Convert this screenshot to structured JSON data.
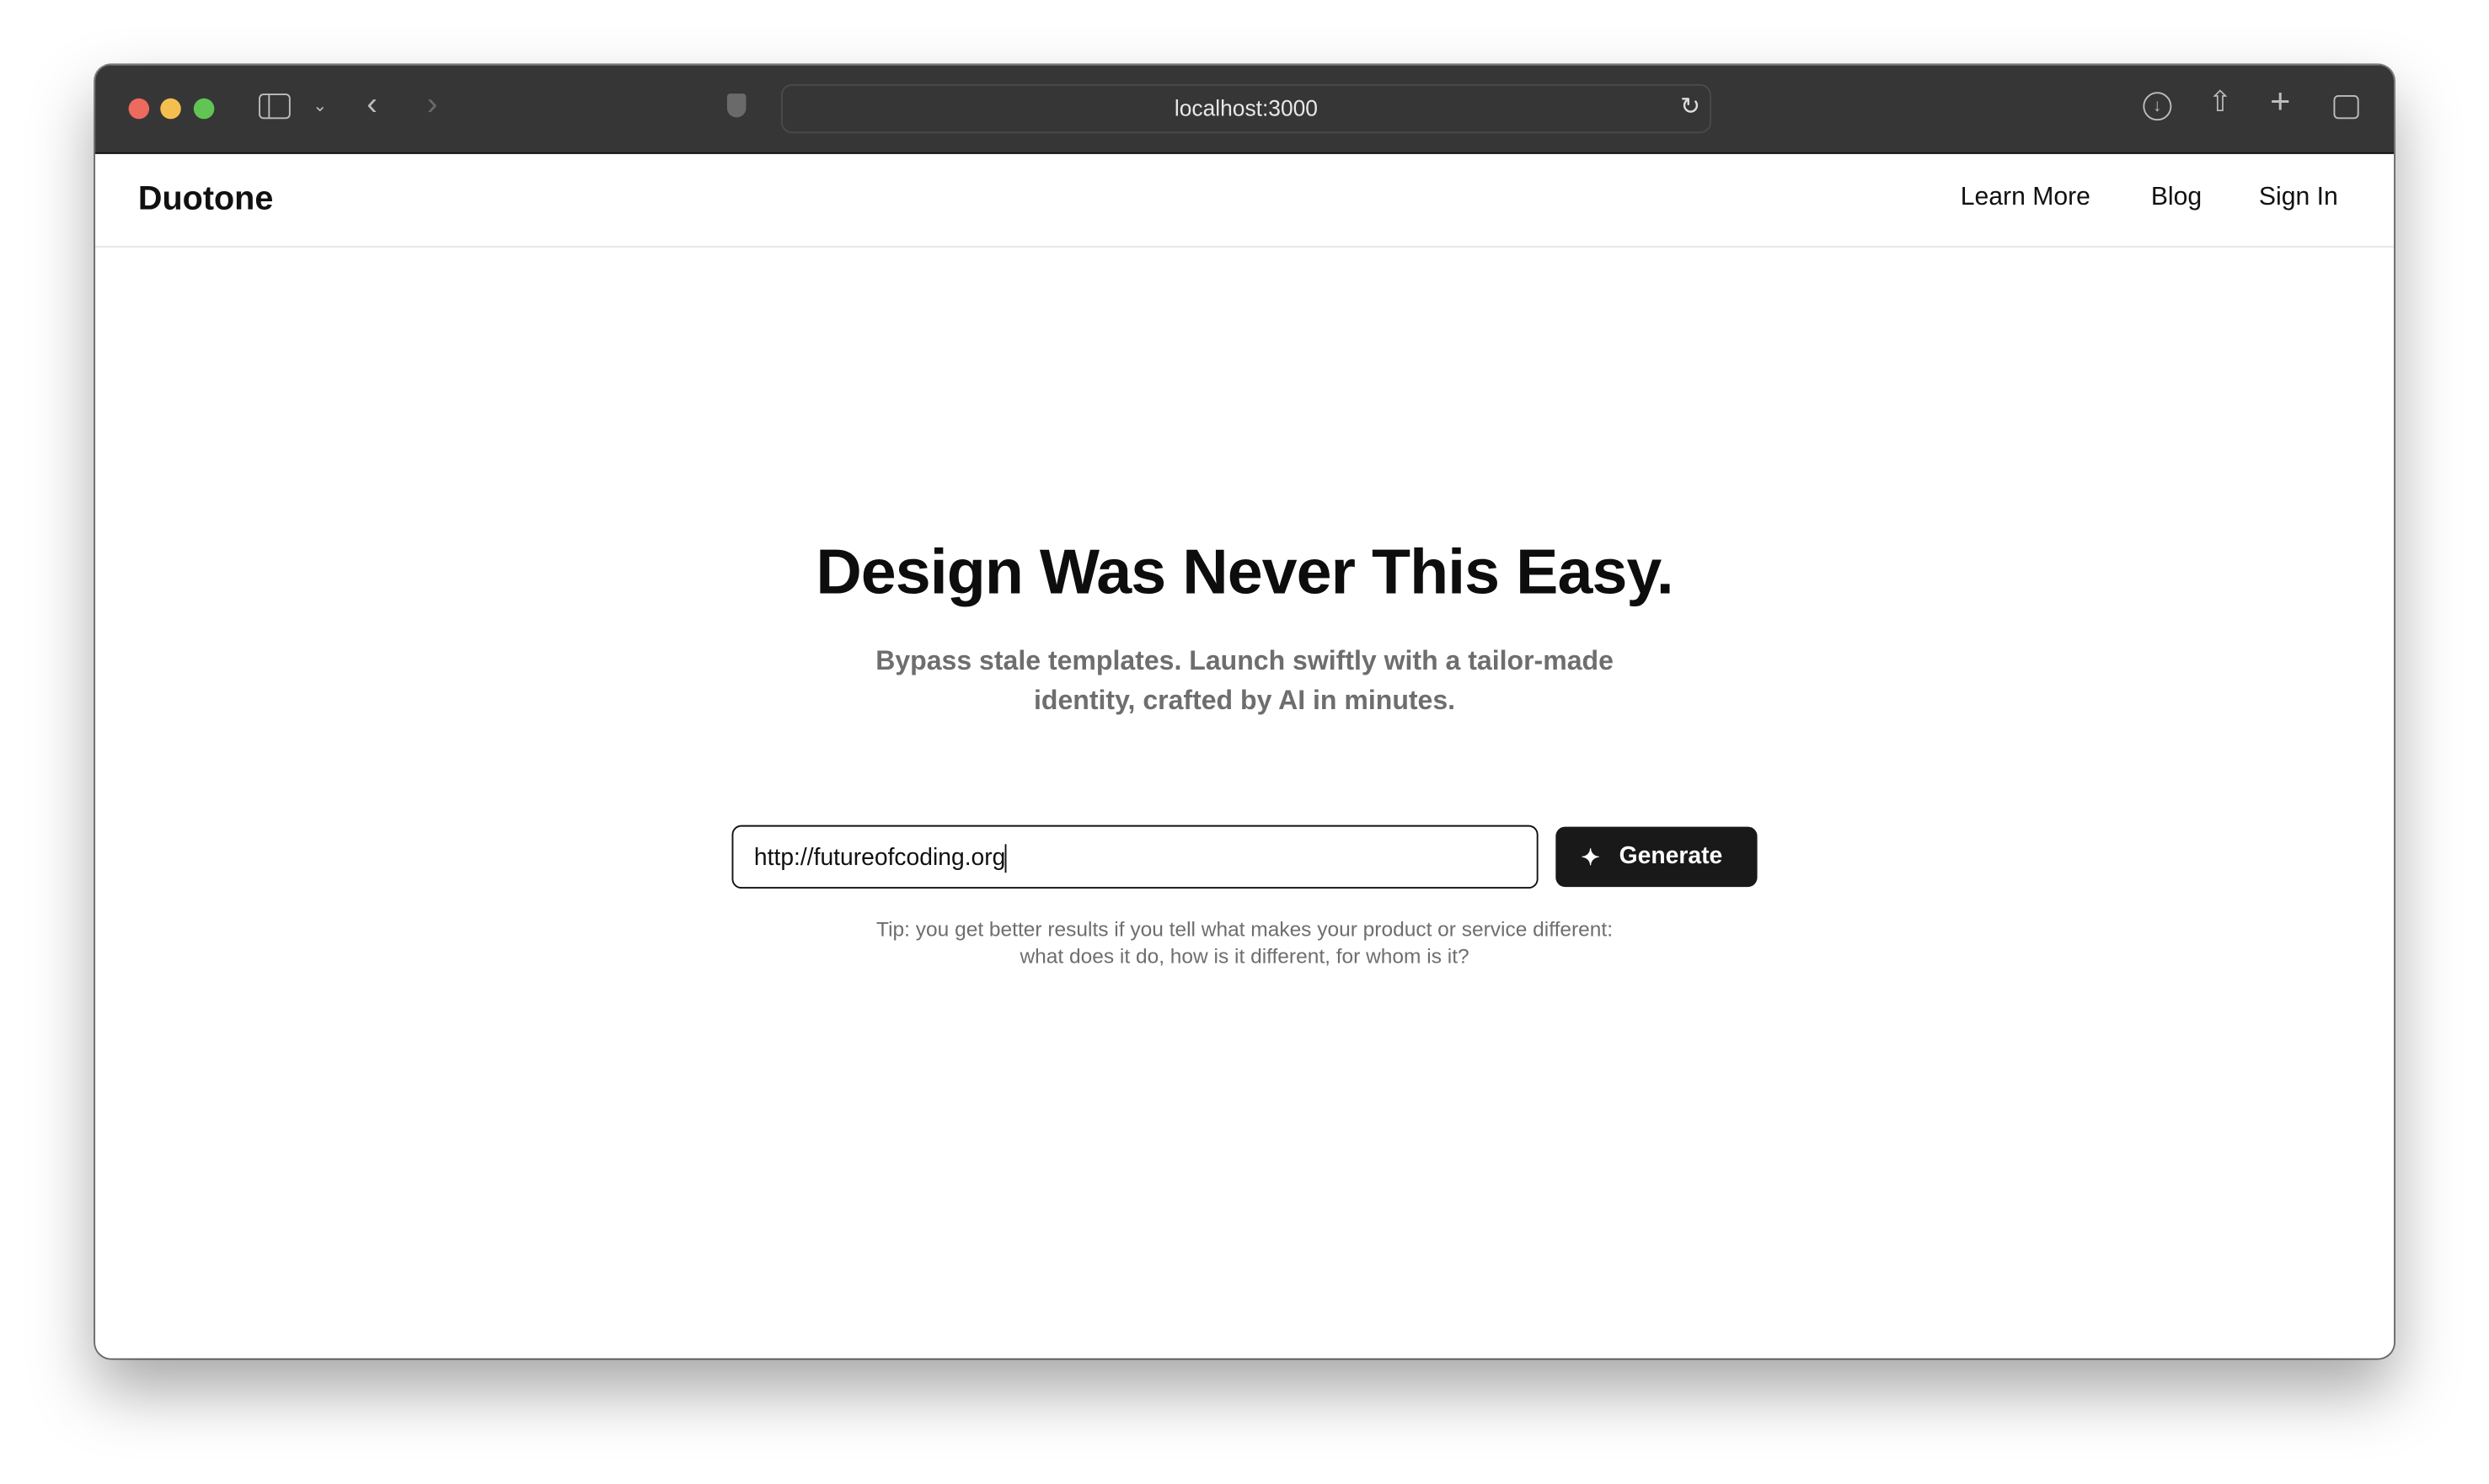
{
  "browser": {
    "url": "localhost:3000",
    "traffic_colors": [
      "#ed6a5e",
      "#f5bf4f",
      "#61c554"
    ],
    "icons": [
      "sidebar-icon",
      "chevron-down-icon",
      "back-icon",
      "forward-icon",
      "shield-icon",
      "reload-icon",
      "download-icon",
      "share-icon",
      "new-tab-icon",
      "tabs-overview-icon"
    ]
  },
  "nav": {
    "logo": "Duotone",
    "links": [
      "Learn More",
      "Blog",
      "Sign In"
    ]
  },
  "hero": {
    "title": "Design Was Never This Easy.",
    "subtitle_line1": "Bypass stale templates. Launch swiftly with a tailor-made",
    "subtitle_line2": "identity, crafted by AI in minutes."
  },
  "form": {
    "input_value": "http://futureofcoding.org",
    "button_label": "Generate",
    "button_icon": "sparkles-icon",
    "tip_line1": "Tip: you get better results if you tell what makes your product or service different:",
    "tip_line2": "what does it do, how is it different, for whom is it?"
  }
}
